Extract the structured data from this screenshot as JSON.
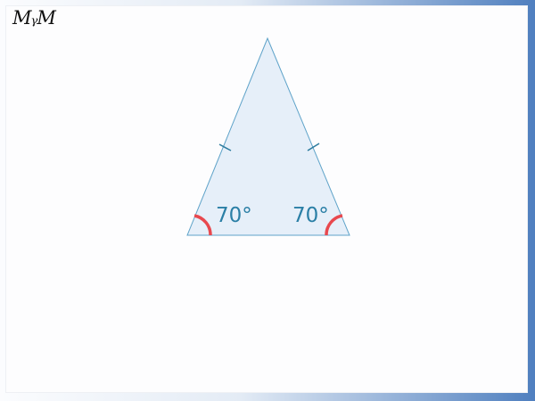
{
  "logo": {
    "text": "MᵧM"
  },
  "diagram": {
    "shape": "isosceles-triangle",
    "fill_color": "#e6eff9",
    "stroke_color": "#5fa3c9",
    "tick_color": "#2b7a9d",
    "arc_color": "#e8484e",
    "label_color": "#2b7fa6",
    "angles": {
      "left": "70°",
      "right": "70°"
    }
  }
}
